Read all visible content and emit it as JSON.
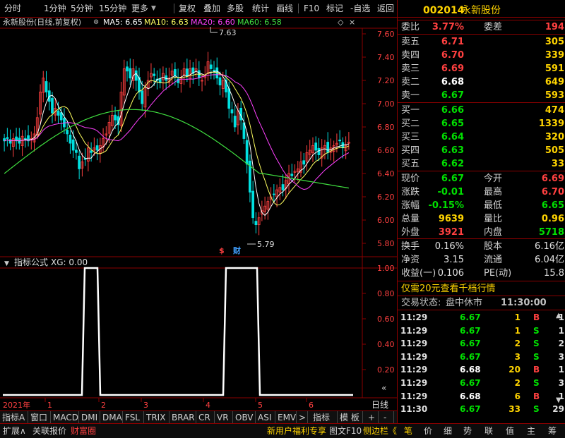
{
  "toolbar": {
    "items": [
      "分时",
      "1分钟",
      "5分钟",
      "15分钟",
      "更多",
      "复权",
      "叠加",
      "多股",
      "统计",
      "画线",
      "F10",
      "标记",
      "-自选",
      "返回"
    ]
  },
  "chart": {
    "stock_label": "永新股份(日线,前复权)",
    "ma5": "MA5: 6.65",
    "ma10": "MA10: 6.63",
    "ma20": "MA20: 6.60",
    "ma60": "MA60: 6.58",
    "price_axis": [
      "7.60",
      "7.40",
      "7.20",
      "7.00",
      "6.80",
      "6.60",
      "6.40",
      "6.20",
      "6.00",
      "5.80"
    ],
    "high_marker": "7.63",
    "low_marker": "5.79",
    "event_markers": [
      "$",
      "财"
    ],
    "colors": {
      "up": "#ff4040",
      "down": "#00e0e0",
      "ma5": "#ffffff",
      "ma10": "#ffff60",
      "ma20": "#ff40ff",
      "ma60": "#40e040",
      "axis": "#8b0000"
    }
  },
  "indicator": {
    "title": "指标公式",
    "value_label": "XG: 0.00",
    "axis": [
      "1.00",
      "0.80",
      "0.60",
      "0.40",
      "0.20"
    ],
    "axis_extra": "«"
  },
  "date_axis": {
    "year": "2021年",
    "months": [
      "1",
      "2",
      "3",
      "4",
      "5",
      "6"
    ],
    "right_label": "日线"
  },
  "indicator_tabs": [
    "指标A",
    "窗口",
    "MACD",
    "DMI",
    "DMA",
    "FSL",
    "TRIX",
    "BRAR",
    "CR",
    "VR",
    "OBV",
    "ASI",
    "EMV",
    ">",
    "指标B",
    "模 板",
    "+",
    "-"
  ],
  "status_bar": {
    "left": [
      "扩展∧",
      "关联报价",
      "财富圈"
    ],
    "middle": [
      "新用户福利专享",
      "图文F10",
      "侧边栏《"
    ],
    "right_tabs": [
      "笔",
      "价",
      "细",
      "势",
      "联",
      "值",
      "主",
      "筹"
    ]
  },
  "quote": {
    "code": "002014",
    "name": "永新股份",
    "weibi_label": "委比",
    "weibi": "3.77%",
    "weicha_label": "委差",
    "weicha": "194",
    "asks": [
      {
        "label": "卖五",
        "price": "6.71",
        "vol": "305",
        "color": "red"
      },
      {
        "label": "卖四",
        "price": "6.70",
        "vol": "339",
        "color": "red"
      },
      {
        "label": "卖三",
        "price": "6.69",
        "vol": "591",
        "color": "red"
      },
      {
        "label": "卖二",
        "price": "6.68",
        "vol": "649",
        "color": "white"
      },
      {
        "label": "卖一",
        "price": "6.67",
        "vol": "593",
        "color": "green"
      }
    ],
    "bids": [
      {
        "label": "买一",
        "price": "6.66",
        "vol": "474",
        "color": "green"
      },
      {
        "label": "买二",
        "price": "6.65",
        "vol": "1339",
        "color": "green"
      },
      {
        "label": "买三",
        "price": "6.64",
        "vol": "320",
        "color": "green"
      },
      {
        "label": "买四",
        "price": "6.63",
        "vol": "505",
        "color": "green"
      },
      {
        "label": "买五",
        "price": "6.62",
        "vol": "33",
        "color": "green"
      }
    ],
    "stats": [
      {
        "l1": "现价",
        "v1": "6.67",
        "c1": "green",
        "l2": "今开",
        "v2": "6.69",
        "c2": "red"
      },
      {
        "l1": "涨跌",
        "v1": "-0.01",
        "c1": "green",
        "l2": "最高",
        "v2": "6.70",
        "c2": "red"
      },
      {
        "l1": "涨幅",
        "v1": "-0.15%",
        "c1": "green",
        "l2": "最低",
        "v2": "6.65",
        "c2": "green"
      },
      {
        "l1": "总量",
        "v1": "9639",
        "c1": "yellow",
        "l2": "量比",
        "v2": "0.96",
        "c2": "yellow"
      },
      {
        "l1": "外盘",
        "v1": "3921",
        "c1": "red",
        "l2": "内盘",
        "v2": "5718",
        "c2": "green"
      }
    ],
    "fund": [
      {
        "l1": "换手",
        "v1": "0.16%",
        "l2": "股本",
        "v2": "6.16亿"
      },
      {
        "l1": "净资",
        "v1": "3.15",
        "l2": "流通",
        "v2": "6.04亿"
      },
      {
        "l1": "收益(一)",
        "v1": "0.106",
        "l2": "PE(动)",
        "v2": "15.8"
      }
    ],
    "promo": "仅需20元查看千档行情",
    "trade_status_label": "交易状态:",
    "trade_status": "盘中休市",
    "trade_time": "11:30:00",
    "ticks": [
      {
        "time": "11:29",
        "price": "6.67",
        "pc": "green",
        "vol": "1",
        "bs": "B",
        "bc": "red",
        "n": "1"
      },
      {
        "time": "11:29",
        "price": "6.67",
        "pc": "green",
        "vol": "1",
        "bs": "S",
        "bc": "green",
        "n": "1"
      },
      {
        "time": "11:29",
        "price": "6.67",
        "pc": "green",
        "vol": "2",
        "bs": "S",
        "bc": "green",
        "n": "2"
      },
      {
        "time": "11:29",
        "price": "6.67",
        "pc": "green",
        "vol": "3",
        "bs": "S",
        "bc": "green",
        "n": "3"
      },
      {
        "time": "11:29",
        "price": "6.68",
        "pc": "white",
        "vol": "20",
        "bs": "B",
        "bc": "red",
        "n": "1"
      },
      {
        "time": "11:29",
        "price": "6.67",
        "pc": "green",
        "vol": "2",
        "bs": "S",
        "bc": "green",
        "n": "3"
      },
      {
        "time": "11:29",
        "price": "6.68",
        "pc": "white",
        "vol": "6",
        "bs": "B",
        "bc": "red",
        "n": "1"
      },
      {
        "time": "11:30",
        "price": "6.67",
        "pc": "green",
        "vol": "33",
        "bs": "S",
        "bc": "green",
        "n": "29"
      }
    ]
  }
}
